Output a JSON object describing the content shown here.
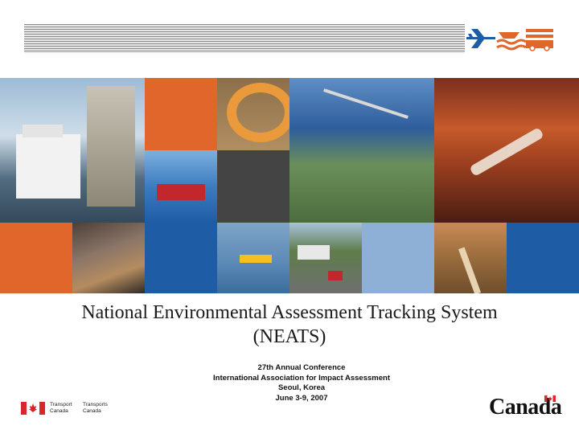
{
  "header": {
    "logo_icons": [
      "airplane-icon",
      "ship-wave-icon",
      "rail-icon"
    ]
  },
  "title": {
    "line1": "National Environmental Assessment Tracking System",
    "line2": "(NEATS)"
  },
  "conference": {
    "line1": "27th Annual Conference",
    "line2": "International Association for Impact Assessment",
    "line3": "Seoul, Korea",
    "line4": "June 3-9, 2007"
  },
  "footer": {
    "tc_en_1": "Transport",
    "tc_en_2": "Canada",
    "tc_fr_1": "Transports",
    "tc_fr_2": "Canada",
    "wordmark": "Canada"
  },
  "colors": {
    "orange": "#e0662c",
    "blue": "#1f5ca6",
    "dark_grey": "#444444",
    "red": "#d8262b"
  }
}
